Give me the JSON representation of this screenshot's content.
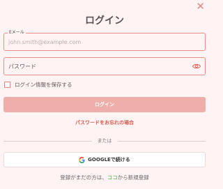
{
  "dialog": {
    "close_glyph": "✕",
    "title": "ログイン"
  },
  "email": {
    "label": "Eメール",
    "placeholder": "john.smith@example.com"
  },
  "password": {
    "placeholder": "パスワード",
    "toggle_icon": "eye-icon"
  },
  "remember": {
    "label": "ログイン情報を保存する",
    "checked": false
  },
  "login_button": {
    "label": "ログイン"
  },
  "forgot_link": {
    "label": "パスワードをお忘れの場合"
  },
  "divider": {
    "label": "または"
  },
  "google_button": {
    "label": "GOOGLEで続ける",
    "icon": "google-icon"
  },
  "signup": {
    "prefix": "登録がまだの方は、",
    "link": "ココ",
    "suffix": "から新規登録"
  },
  "colors": {
    "background": "#fff4f3",
    "accent": "#ea8d88",
    "button_disabled": "#eeaeaa",
    "link_red": "#d95c50",
    "link_green": "#3fae4c"
  }
}
